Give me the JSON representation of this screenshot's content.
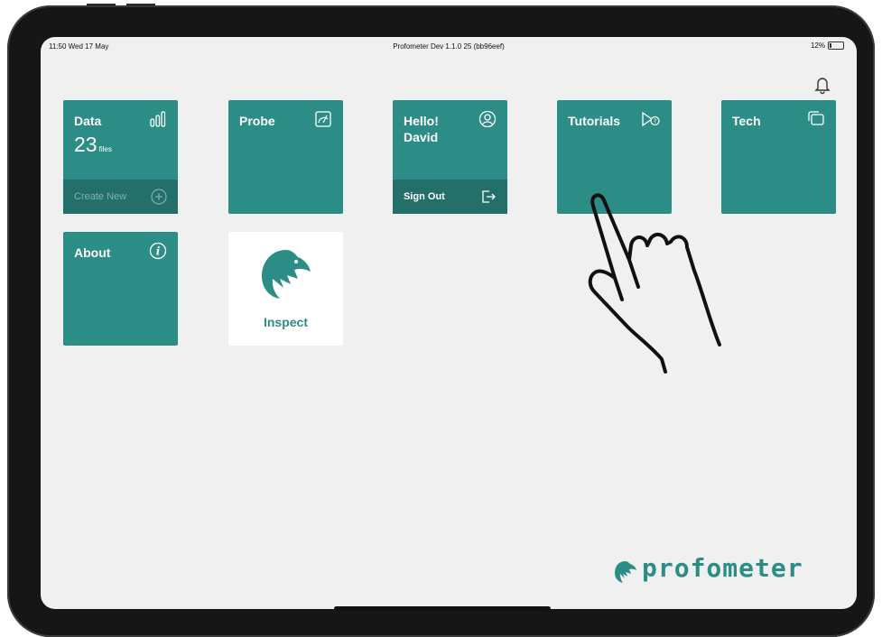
{
  "statusbar": {
    "time": "11:50  Wed 17 May",
    "title": "Profometer Dev 1.1.0 25 (bb96eef)",
    "battery": "12%"
  },
  "tiles": {
    "data": {
      "title": "Data",
      "count": "23",
      "unit": "files",
      "footer": "Create New",
      "icon": "bar-chart-icon"
    },
    "probe": {
      "title": "Probe",
      "icon": "gauge-icon"
    },
    "hello": {
      "title_line1": "Hello!",
      "title_line2": "David",
      "footer": "Sign Out",
      "icon": "user-circle-icon"
    },
    "tutorials": {
      "title": "Tutorials",
      "icon": "video-help-icon"
    },
    "tech": {
      "title": "Tech",
      "icon": "cards-icon"
    },
    "about": {
      "title": "About",
      "icon": "info-icon"
    },
    "inspect": {
      "title": "Inspect",
      "icon": "eagle-logo-icon"
    }
  },
  "brand": {
    "name": "profometer",
    "color": "#2b8d86"
  },
  "overlay": {
    "icon": "tap-hand-icon"
  }
}
